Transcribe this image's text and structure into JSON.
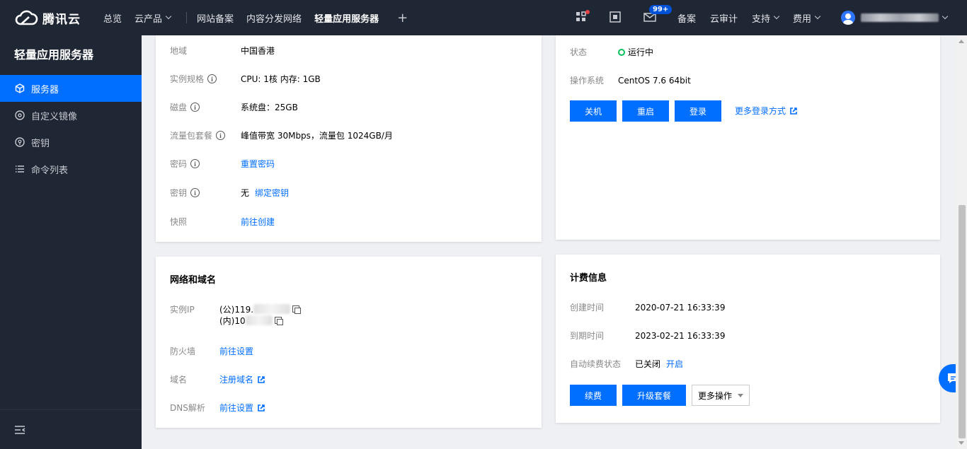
{
  "header": {
    "brand": "腾讯云",
    "nav": [
      "总览",
      "云产品"
    ],
    "pinned": [
      "网站备案",
      "内容分发网络",
      "轻量应用服务器"
    ],
    "badge": "99+",
    "links": [
      "备案",
      "云审计",
      "支持",
      "费用"
    ],
    "colors": {
      "bg": "#1f2634",
      "accent": "#006eff"
    }
  },
  "sidebar": {
    "title": "轻量应用服务器",
    "items": [
      {
        "label": "服务器",
        "icon": "cube-icon",
        "active": true
      },
      {
        "label": "自定义镜像",
        "icon": "disc-icon"
      },
      {
        "label": "密钥",
        "icon": "key-icon"
      },
      {
        "label": "命令列表",
        "icon": "list-icon"
      }
    ]
  },
  "instance": {
    "region_label": "地域",
    "region": "中国香港",
    "spec_label": "实例规格",
    "spec": "CPU: 1核 内存: 1GB",
    "disk_label": "磁盘",
    "disk": "系统盘：25GB",
    "traffic_label": "流量包套餐",
    "traffic": "峰值带宽 30Mbps，流量包 1024GB/月",
    "password_label": "密码",
    "password_link": "重置密码",
    "key_label": "密钥",
    "key_value": "无",
    "key_link": "绑定密钥",
    "snapshot_label": "快照",
    "snapshot_link": "前往创建"
  },
  "status": {
    "state_label": "状态",
    "state": "运行中",
    "os_label": "操作系统",
    "os": "CentOS 7.6 64bit",
    "buttons": [
      "关机",
      "重启",
      "登录"
    ],
    "more_login": "更多登录方式"
  },
  "network": {
    "title": "网络和域名",
    "ip_label": "实例IP",
    "ip_public": "(公)119.",
    "ip_private": "(内)10",
    "firewall_label": "防火墙",
    "firewall_link": "前往设置",
    "domain_label": "域名",
    "domain_link": "注册域名",
    "dns_label": "DNS解析",
    "dns_link": "前往设置"
  },
  "billing": {
    "title": "计费信息",
    "created_label": "创建时间",
    "created": "2020-07-21 16:33:39",
    "expire_label": "到期时间",
    "expire": "2023-02-21 16:33:39",
    "renew_label": "自动续费状态",
    "renew_value": "已关闭",
    "renew_link": "开启",
    "buttons": [
      "续费",
      "升级套餐"
    ],
    "more": "更多操作"
  }
}
